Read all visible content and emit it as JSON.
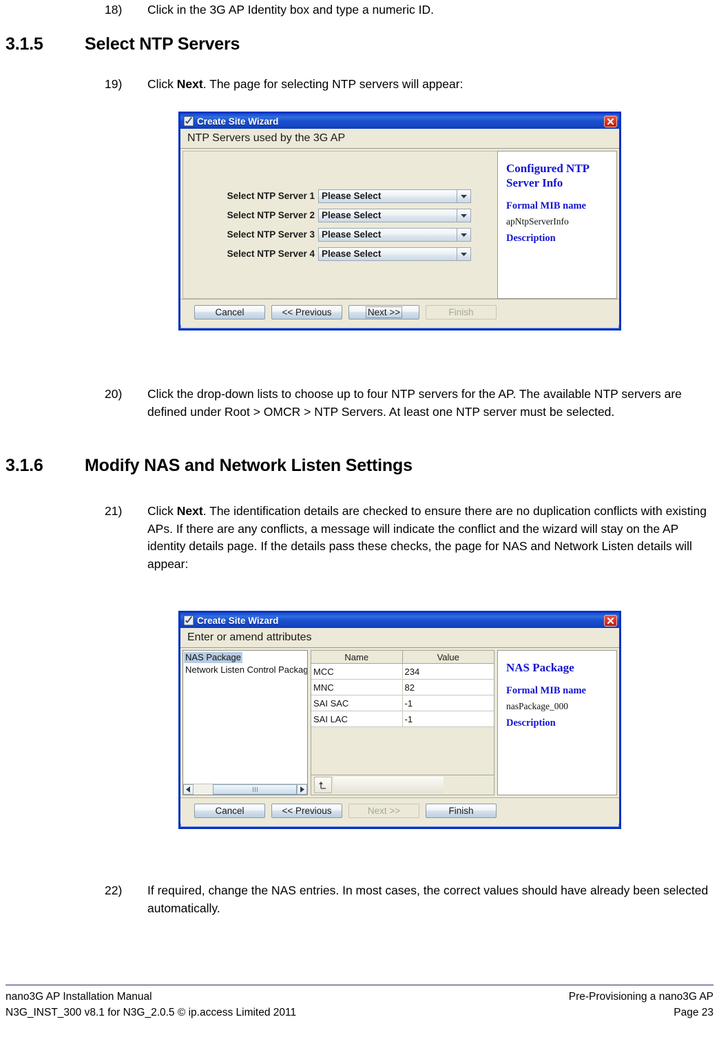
{
  "steps": {
    "step18": {
      "num": "18)",
      "text": "Click in the 3G AP Identity box and type a numeric ID."
    },
    "step19_pre": "Click ",
    "step19_bold": "Next",
    "step19_post": ". The page for selecting NTP servers will appear:",
    "step19_num": "19)",
    "step20": {
      "num": "20)",
      "text": "Click the drop-down lists to choose up to four NTP servers for the AP. The available NTP servers are defined under Root > OMCR > NTP Servers. At least one NTP server must be selected."
    },
    "step21_num": "21)",
    "step21_pre": "Click ",
    "step21_bold": "Next",
    "step21_post": ". The identification details are checked to ensure there are no duplication conflicts with existing APs. If there are any conflicts, a message will indicate the conflict and the wizard will stay on the AP identity details page. If the details pass these checks, the page for NAS and Network Listen details will appear:",
    "step22": {
      "num": "22)",
      "text": "If required, change the NAS entries. In most cases, the correct values should have already been selected automatically."
    }
  },
  "headings": {
    "h315_num": "3.1.5",
    "h315_text": "Select NTP Servers",
    "h316_num": "3.1.6",
    "h316_text": "Modify NAS and Network Listen Settings"
  },
  "ntp_dialog": {
    "window_title": "Create Site Wizard",
    "header": "NTP Servers used by the 3G AP",
    "rows": [
      {
        "label": "Select NTP Server 1",
        "value": "Please Select"
      },
      {
        "label": "Select NTP Server 2",
        "value": "Please Select"
      },
      {
        "label": "Select NTP Server 3",
        "value": "Please Select"
      },
      {
        "label": "Select NTP Server 4",
        "value": "Please Select"
      }
    ],
    "info": {
      "title": "Configured NTP Server Info",
      "mib_label": "Formal MIB name",
      "mib_value": "apNtpServerInfo",
      "description_label": "Description"
    },
    "buttons": {
      "cancel": "Cancel",
      "previous": "<< Previous",
      "next": "Next >>",
      "finish": "Finish"
    }
  },
  "attr_dialog": {
    "window_title": "Create Site Wizard",
    "header": "Enter or amend attributes",
    "tree_items": [
      {
        "label": "NAS Package",
        "selected": true
      },
      {
        "label": "Network Listen Control Package",
        "selected": false
      }
    ],
    "table": {
      "columns": [
        "Name",
        "Value"
      ],
      "rows": [
        [
          "MCC",
          "234"
        ],
        [
          "MNC",
          "82"
        ],
        [
          "SAI SAC",
          "-1"
        ],
        [
          "SAI LAC",
          "-1"
        ]
      ]
    },
    "info": {
      "title": "NAS Package",
      "mib_label": "Formal MIB name",
      "mib_value": "nasPackage_000",
      "description_label": "Description"
    },
    "buttons": {
      "cancel": "Cancel",
      "previous": "<< Previous",
      "next": "Next >>",
      "finish": "Finish"
    }
  },
  "footer": {
    "left_line1": "nano3G AP Installation Manual",
    "left_line2": "N3G_INST_300 v8.1 for N3G_2.0.5 © ip.access Limited 2011",
    "right_line1": "Pre-Provisioning a nano3G AP",
    "right_line2": "Page 23"
  },
  "colors": {
    "title_blue": "#1a4fce",
    "info_blue": "#1414d2",
    "frame_blue": "#0633c4",
    "close_red": "#d83a2b",
    "selection_blue": "#b7cce3"
  }
}
